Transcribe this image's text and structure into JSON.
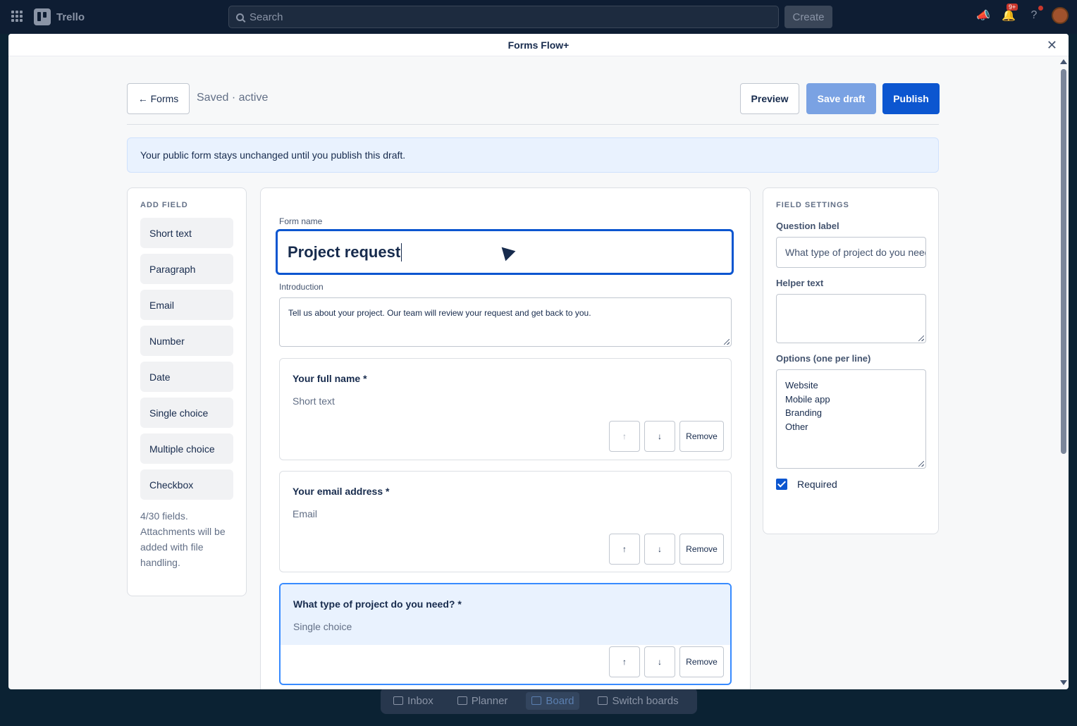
{
  "topbar": {
    "app_name": "Trello",
    "search_placeholder": "Search",
    "create_label": "Create",
    "notification_badge": "9+"
  },
  "bottom_nav": {
    "items": [
      {
        "label": "Inbox",
        "active": false
      },
      {
        "label": "Planner",
        "active": false
      },
      {
        "label": "Board",
        "active": true
      },
      {
        "label": "Switch boards",
        "active": false
      }
    ]
  },
  "modal": {
    "title": "Forms Flow+",
    "back_label": "← Forms",
    "status": "Saved · active",
    "preview_label": "Preview",
    "save_draft_label": "Save draft",
    "publish_label": "Publish",
    "banner": "Your public form stays unchanged until you publish this draft."
  },
  "add_field": {
    "heading": "ADD FIELD",
    "types": [
      "Short text",
      "Paragraph",
      "Email",
      "Number",
      "Date",
      "Single choice",
      "Multiple choice",
      "Checkbox"
    ],
    "count_note": "4/30 fields. Attachments will be added with file handling."
  },
  "editor": {
    "form_name_label": "Form name",
    "form_name_value": "Project request",
    "intro_label": "Introduction",
    "intro_value": "Tell us about your project. Our team will review your request and get back to you.",
    "questions": [
      {
        "title": "Your full name *",
        "type": "Short text",
        "selected": false
      },
      {
        "title": "Your email address *",
        "type": "Email",
        "selected": false
      },
      {
        "title": "What type of project do you need? *",
        "type": "Single choice",
        "selected": true
      }
    ],
    "up_label": "↑",
    "down_label": "↓",
    "remove_label": "Remove"
  },
  "field_settings": {
    "heading": "FIELD SETTINGS",
    "question_label_label": "Question label",
    "question_label_value": "What type of project do you need?",
    "helper_text_label": "Helper text",
    "helper_text_value": "",
    "options_label": "Options (one per line)",
    "options": [
      "Website",
      "Mobile app",
      "Branding",
      "Other"
    ],
    "required_label": "Required",
    "required_checked": true
  },
  "colors": {
    "accent": "#0c56d0",
    "save_draft_disabled": "#7aa2e3",
    "selected_card_bg": "#e9f2fe",
    "topbar_bg": "#0e1d33"
  }
}
